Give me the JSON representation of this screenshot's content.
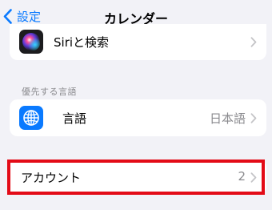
{
  "navbar": {
    "back_label": "設定",
    "title": "カレンダー"
  },
  "siri_row": {
    "label": "Siriと検索",
    "icon": "siri-icon"
  },
  "language_section": {
    "header": "優先する言語",
    "row": {
      "label": "言語",
      "value": "日本語",
      "icon": "globe-icon"
    }
  },
  "accounts_row": {
    "label": "アカウント",
    "value": "2"
  },
  "colors": {
    "accent": "#0a7aff",
    "highlight": "#e30b17",
    "language_icon_bg": "#0a7aff"
  }
}
